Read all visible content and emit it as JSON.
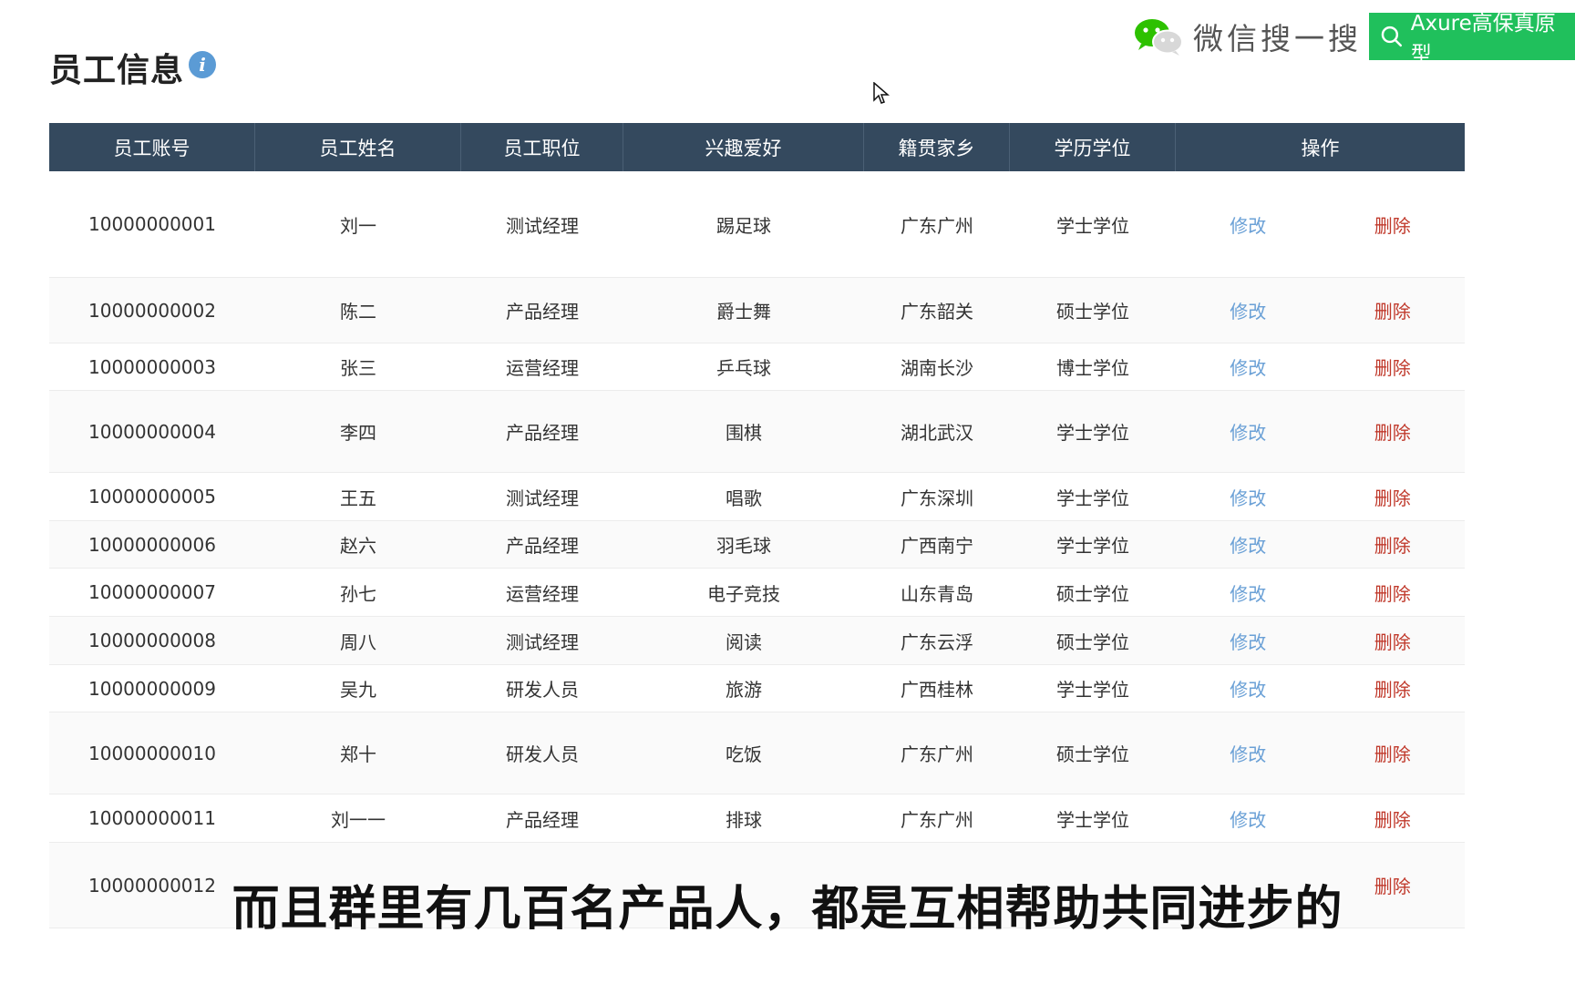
{
  "page": {
    "title": "员工信息",
    "info_icon": "i"
  },
  "banner": {
    "wechat_text": "微信搜一搜",
    "search_text": "Axure高保真原型"
  },
  "table": {
    "headers": [
      "员工账号",
      "员工姓名",
      "员工职位",
      "兴趣爱好",
      "籍贯家乡",
      "学历学位",
      "操作"
    ],
    "edit_label": "修改",
    "delete_label": "删除",
    "rows": [
      {
        "id": "10000000001",
        "name": "刘一",
        "position": "测试经理",
        "hobby": "踢足球",
        "hometown": "广东广州",
        "degree": "学士学位",
        "edit": "修改",
        "delete": "删除"
      },
      {
        "id": "10000000002",
        "name": "陈二",
        "position": "产品经理",
        "hobby": "爵士舞",
        "hometown": "广东韶关",
        "degree": "硕士学位",
        "edit": "修改",
        "delete": "删除"
      },
      {
        "id": "10000000003",
        "name": "张三",
        "position": "运营经理",
        "hobby": "乒乓球",
        "hometown": "湖南长沙",
        "degree": "博士学位",
        "edit": "修改",
        "delete": "删除"
      },
      {
        "id": "10000000004",
        "name": "李四",
        "position": "产品经理",
        "hobby": "围棋",
        "hometown": "湖北武汉",
        "degree": "学士学位",
        "edit": "修改",
        "delete": "删除"
      },
      {
        "id": "10000000005",
        "name": "王五",
        "position": "测试经理",
        "hobby": "唱歌",
        "hometown": "广东深圳",
        "degree": "学士学位",
        "edit": "修改",
        "delete": "删除"
      },
      {
        "id": "10000000006",
        "name": "赵六",
        "position": "产品经理",
        "hobby": "羽毛球",
        "hometown": "广西南宁",
        "degree": "学士学位",
        "edit": "修改",
        "delete": "删除"
      },
      {
        "id": "10000000007",
        "name": "孙七",
        "position": "运营经理",
        "hobby": "电子竞技",
        "hometown": "山东青岛",
        "degree": "硕士学位",
        "edit": "修改",
        "delete": "删除"
      },
      {
        "id": "10000000008",
        "name": "周八",
        "position": "测试经理",
        "hobby": "阅读",
        "hometown": "广东云浮",
        "degree": "硕士学位",
        "edit": "修改",
        "delete": "删除"
      },
      {
        "id": "10000000009",
        "name": "吴九",
        "position": "研发人员",
        "hobby": "旅游",
        "hometown": "广西桂林",
        "degree": "学士学位",
        "edit": "修改",
        "delete": "删除"
      },
      {
        "id": "10000000010",
        "name": "郑十",
        "position": "研发人员",
        "hobby": "吃饭",
        "hometown": "广东广州",
        "degree": "硕士学位",
        "edit": "修改",
        "delete": "删除"
      },
      {
        "id": "10000000011",
        "name": "刘一一",
        "position": "产品经理",
        "hobby": "排球",
        "hometown": "广东广州",
        "degree": "学士学位",
        "edit": "修改",
        "delete": "删除"
      },
      {
        "id": "10000000012",
        "name": "",
        "position": "",
        "hobby": "",
        "hometown": "",
        "degree": "",
        "edit": "",
        "delete": "删除"
      }
    ]
  },
  "subtitle": "而且群里有几百名产品人，都是互相帮助共同进步的"
}
